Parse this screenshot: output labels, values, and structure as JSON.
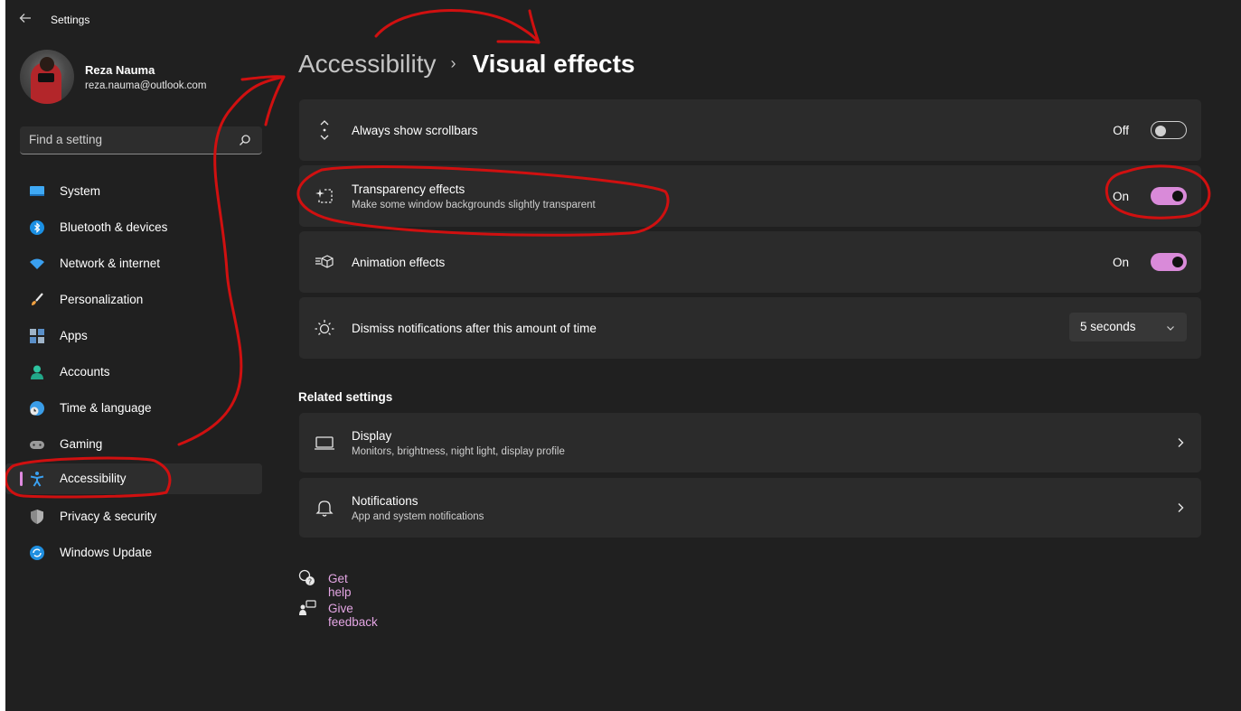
{
  "titlebar": {
    "back_icon": "back-arrow-icon",
    "title": "Settings"
  },
  "profile": {
    "name": "Reza Nauma",
    "email": "reza.nauma@outlook.com"
  },
  "search": {
    "placeholder": "Find a setting"
  },
  "nav": {
    "items": [
      {
        "label": "System",
        "icon": "system-icon"
      },
      {
        "label": "Bluetooth & devices",
        "icon": "bluetooth-icon"
      },
      {
        "label": "Network & internet",
        "icon": "wifi-icon"
      },
      {
        "label": "Personalization",
        "icon": "brush-icon"
      },
      {
        "label": "Apps",
        "icon": "apps-icon"
      },
      {
        "label": "Accounts",
        "icon": "account-icon"
      },
      {
        "label": "Time & language",
        "icon": "globe-clock-icon"
      },
      {
        "label": "Gaming",
        "icon": "gamepad-icon"
      },
      {
        "label": "Accessibility",
        "icon": "accessibility-icon",
        "active": true
      },
      {
        "label": "Privacy & security",
        "icon": "shield-icon"
      },
      {
        "label": "Windows Update",
        "icon": "update-icon"
      }
    ]
  },
  "header": {
    "parent": "Accessibility",
    "separator": "›",
    "current": "Visual effects"
  },
  "settings": {
    "scrollbars": {
      "title": "Always show scrollbars",
      "state_label": "Off",
      "on": false
    },
    "transparency": {
      "title": "Transparency effects",
      "subtitle": "Make some window backgrounds slightly transparent",
      "state_label": "On",
      "on": true
    },
    "animation": {
      "title": "Animation effects",
      "state_label": "On",
      "on": true
    },
    "dismiss": {
      "title": "Dismiss notifications after this amount of time",
      "value": "5 seconds"
    }
  },
  "related": {
    "title": "Related settings",
    "items": [
      {
        "title": "Display",
        "subtitle": "Monitors, brightness, night light, display profile",
        "icon": "monitor-icon"
      },
      {
        "title": "Notifications",
        "subtitle": "App and system notifications",
        "icon": "bell-icon"
      }
    ]
  },
  "links": {
    "help": "Get help",
    "feedback": "Give feedback"
  },
  "colors": {
    "window_bg": "#202020",
    "card_bg": "#2b2b2b",
    "accent": "#d98ad9",
    "link": "#e4a6e4",
    "annotation": "#d01010"
  }
}
